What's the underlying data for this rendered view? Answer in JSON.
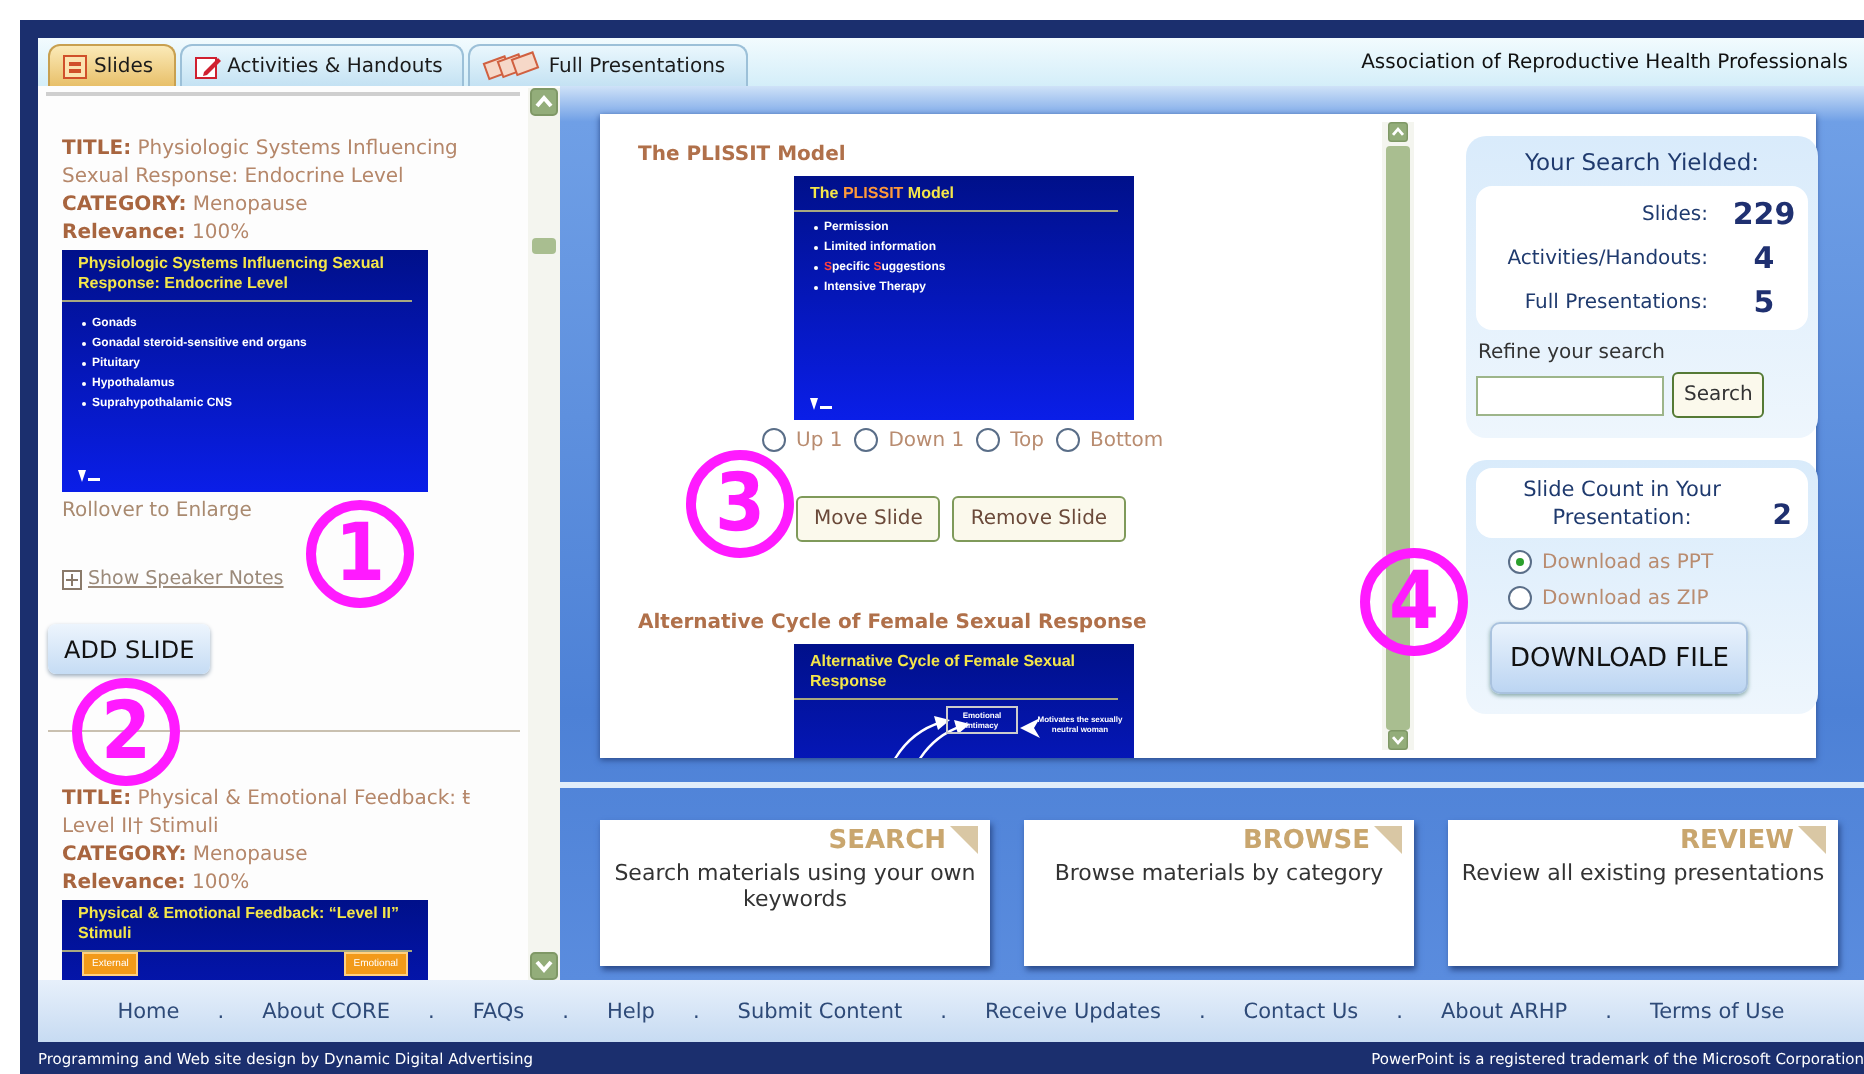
{
  "tabs": [
    {
      "label": "Slides",
      "kind": "slides",
      "selected": true
    },
    {
      "label": "Activities & Handouts",
      "kind": "handouts",
      "selected": false
    },
    {
      "label": "Full Presentations",
      "kind": "presentations",
      "selected": false
    }
  ],
  "org_name": "Association of Reproductive Health Professionals",
  "results": [
    {
      "title_label": "TITLE:",
      "title": "Physiologic Systems Influencing Sexual Response: Endocrine Level",
      "category_label": "CATEGORY:",
      "category": "Menopause",
      "relevance_label": "Relevance:",
      "relevance": "100%",
      "slide": {
        "kind": "bullets",
        "title": "Physiologic Systems Influencing Sexual Response: Endocrine  Level",
        "bullets": [
          "Gonads",
          "Gonadal steroid-sensitive end organs",
          "Pituitary",
          "Hypothalamus",
          "Suprahypothalamic CNS"
        ]
      },
      "rollover": "Rollover to Enlarge",
      "notes_link": "Show Speaker Notes",
      "add_button": "ADD SLIDE"
    },
    {
      "title_label": "TITLE:",
      "title": "Physical & Emotional Feedback: ŧ Level II† Stimuli",
      "category_label": "CATEGORY:",
      "category": "Menopause",
      "relevance_label": "Relevance:",
      "relevance": "100%",
      "slide": {
        "kind": "boxes",
        "title": "Physical & Emotional Feedback: “Level II” Stimuli",
        "boxes": [
          "External",
          "Emotional"
        ]
      }
    }
  ],
  "presentation": {
    "slides": [
      {
        "title": "The PLISSIT Model",
        "slide": {
          "kind": "bullets",
          "title": "The **PLISSIT** Model",
          "bullets": [
            "Permission",
            "Limited information",
            "**S**pecific **S**uggestions",
            "Intensive Therapy"
          ]
        }
      },
      {
        "title": "Alternative Cycle of Female Sexual Response",
        "slide": {
          "kind": "diagram",
          "title": "Alternative Cycle of Female Sexual Response",
          "labels": [
            "Emotional intimacy",
            "Motivates the sexually neutral woman"
          ]
        }
      }
    ],
    "move_options": [
      {
        "label": "Up 1",
        "selected": false
      },
      {
        "label": "Down 1",
        "selected": false
      },
      {
        "label": "Top",
        "selected": false
      },
      {
        "label": "Bottom",
        "selected": false
      }
    ],
    "buttons": [
      "Move Slide",
      "Remove Slide"
    ]
  },
  "search_summary": {
    "heading": "Your Search Yielded:",
    "rows": [
      {
        "label": "Slides:",
        "value": "229"
      },
      {
        "label": "Activities/Handouts:",
        "value": "4"
      },
      {
        "label": "Full Presentations:",
        "value": "5"
      }
    ],
    "refine_label": "Refine your search",
    "search_button": "Search"
  },
  "slide_count": {
    "label": "Slide Count in Your Presentation:",
    "value": "2",
    "formats": [
      {
        "label": "Download as PPT",
        "selected": true
      },
      {
        "label": "Download as ZIP",
        "selected": false
      }
    ],
    "download_button": "DOWNLOAD FILE"
  },
  "cards": [
    {
      "title": "SEARCH",
      "description": "Search materials using your own keywords"
    },
    {
      "title": "BROWSE",
      "description": "Browse materials by category"
    },
    {
      "title": "REVIEW",
      "description": "Review all existing presentations"
    }
  ],
  "nav": {
    "separator": ".",
    "items": [
      "Home",
      "About CORE",
      "FAQs",
      "Help",
      "Submit Content",
      "Receive Updates",
      "Contact Us",
      "About ARHP",
      "Terms of Use"
    ]
  },
  "credits_left": "Programming and Web site design by Dynamic Digital Advertising",
  "credits_right": "PowerPoint is a registered trademark of the Microsoft Corporation",
  "annotations": [
    {
      "label": "1"
    },
    {
      "label": "2"
    },
    {
      "label": "3"
    },
    {
      "label": "4"
    }
  ]
}
